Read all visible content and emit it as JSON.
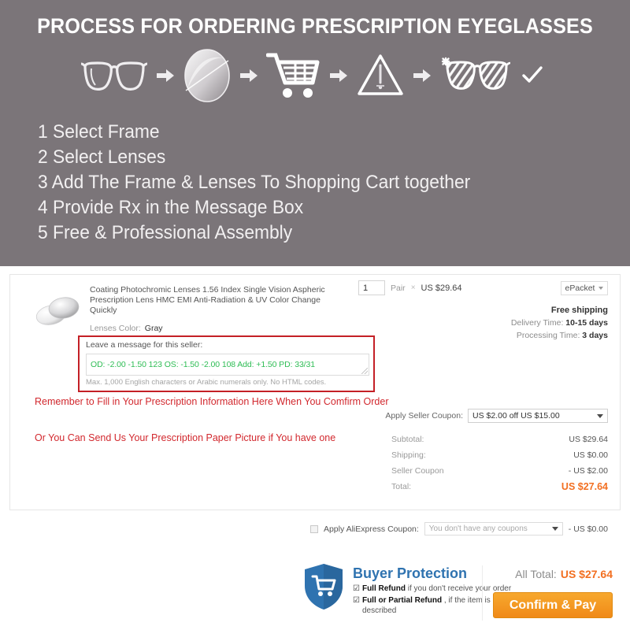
{
  "banner": {
    "title": "PROCESS FOR ORDERING PRESCRIPTION EYEGLASSES",
    "process_icons": [
      {
        "name": "eyeglasses-frame-icon",
        "label": "Select Frame"
      },
      {
        "name": "lens-icon",
        "label": "Select Lenses"
      },
      {
        "name": "shopping-cart-icon",
        "label": "Shopping Cart"
      },
      {
        "name": "warning-triangle-icon",
        "label": "Provide Rx"
      },
      {
        "name": "finished-eyeglasses-icon",
        "label": "Assembly"
      },
      {
        "name": "checkmark-icon",
        "label": "Done"
      }
    ],
    "arrow_glyph": "➜",
    "check_glyph": "✓",
    "steps": [
      "1 Select Frame",
      "2 Select Lenses",
      "3 Add The Frame & Lenses To Shopping Cart together",
      "4 Provide Rx in the Message Box",
      "5 Free & Professional Assembly"
    ]
  },
  "order": {
    "product_title": "Coating Photochromic Lenses 1.56 Index Single Vision Aspheric Prescription Lens HMC EMI Anti-Radiation & UV Color Change Quickly",
    "lenses_color_label": "Lenses Color:",
    "lenses_color_value": "Gray",
    "quantity": "1",
    "quantity_unit": "Pair",
    "multiply_symbol": "×",
    "unit_price": "US $29.64",
    "shipping_method": "ePacket",
    "free_shipping": "Free shipping",
    "delivery_time_label": "Delivery Time:",
    "delivery_time_value": "10-15 days",
    "processing_time_label": "Processing Time:",
    "processing_time_value": "3 days",
    "message_label": "Leave a message for this seller:",
    "message_value": "OD: -2.00  -1.50  123      OS: -1.50  -2.00  108      Add: +1.50  PD: 33/31",
    "message_parts": [
      "OD: -2.00",
      "-1.50",
      "123",
      "",
      "OS: -1.50",
      "-2.00",
      "108",
      "",
      "Add: +1.50",
      "PD: 33/31"
    ],
    "message_hint": "Max. 1,000 English characters or Arabic numerals only. No HTML codes.",
    "red_note_1": "Remember to Fill in Your Prescription Information Here When You Comfirm Order",
    "red_note_2": "Or You Can Send Us Your Prescription Paper Picture if You have one",
    "seller_coupon_label": "Apply Seller Coupon:",
    "seller_coupon_value": "US $2.00 off US $15.00",
    "totals": [
      {
        "label": "Subtotal:",
        "value": "US $29.64"
      },
      {
        "label": "Shipping:",
        "value": "US $0.00"
      },
      {
        "label": "Seller Coupon",
        "value": "- US $2.00"
      },
      {
        "label": "Total:",
        "value": "US $27.64"
      }
    ],
    "ali_coupon_label": "Apply AliExpress Coupon:",
    "ali_coupon_value": "You don't have any coupons",
    "ali_coupon_amount": "- US $0.00"
  },
  "footer": {
    "buyer_protection_title": "Buyer Protection",
    "protection_items": [
      {
        "bold": "Full Refund",
        "rest": "if you don't receive your order"
      },
      {
        "bold": "Full or Partial Refund",
        "rest": ", if the item is not as described"
      }
    ],
    "check_glyph": "☑",
    "all_total_label": "All Total:",
    "all_total_value": "US $27.64",
    "confirm_button": "Confirm & Pay"
  },
  "colors": {
    "banner_bg": "#7b7579",
    "accent_orange": "#f26f21",
    "red_note": "#d2282e",
    "green_text": "#2fbd55",
    "blue_protection": "#2f73b0",
    "msg_border_red": "#c42026"
  }
}
